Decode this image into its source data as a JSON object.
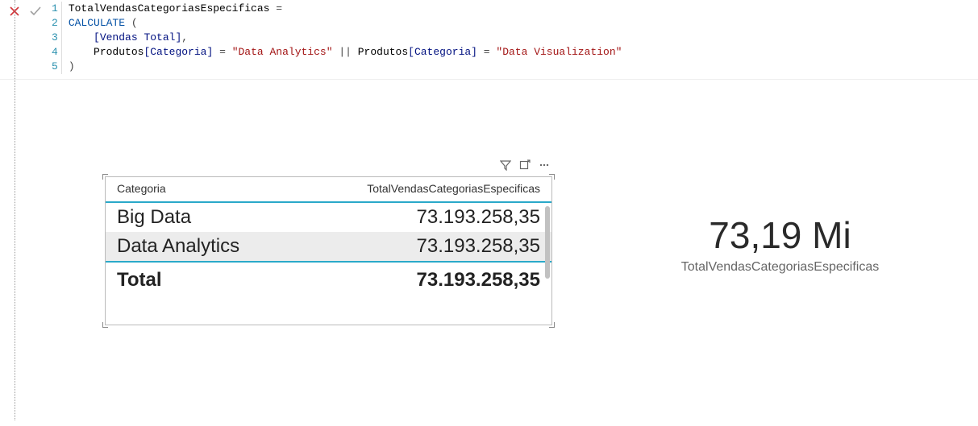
{
  "formula": {
    "line_numbers": [
      "1",
      "2",
      "3",
      "4",
      "5"
    ],
    "l1_measure": "TotalVendasCategoriasEspecificas",
    "l1_eq": " = ",
    "l2_indent": "",
    "l2_fn": "CALCULATE",
    "l2_open": " (",
    "l3_indent": "    ",
    "l3_col": "[Vendas Total]",
    "l3_comma": ",",
    "l4_indent": "    ",
    "l4_tbl1": "Produtos",
    "l4_col1": "[Categoria]",
    "l4_eq1": " = ",
    "l4_str1": "\"Data Analytics\"",
    "l4_or": " || ",
    "l4_tbl2": "Produtos",
    "l4_col2": "[Categoria]",
    "l4_eq2": " = ",
    "l4_str2": "\"Data Visualization\"",
    "l5_close": ")"
  },
  "table": {
    "headers": [
      "Categoria",
      "TotalVendasCategoriasEspecificas"
    ],
    "rows": [
      {
        "cat": "Big Data",
        "val": "73.193.258,35"
      },
      {
        "cat": "Data Analytics",
        "val": "73.193.258,35"
      }
    ],
    "total_label": "Total",
    "total_value": "73.193.258,35"
  },
  "card": {
    "value": "73,19 Mi",
    "label": "TotalVendasCategoriasEspecificas"
  },
  "chart_data": {
    "type": "table",
    "columns": [
      "Categoria",
      "TotalVendasCategoriasEspecificas"
    ],
    "rows": [
      [
        "Big Data",
        73193258.35
      ],
      [
        "Data Analytics",
        73193258.35
      ]
    ],
    "total": 73193258.35,
    "card_value_display": "73,19 Mi"
  }
}
